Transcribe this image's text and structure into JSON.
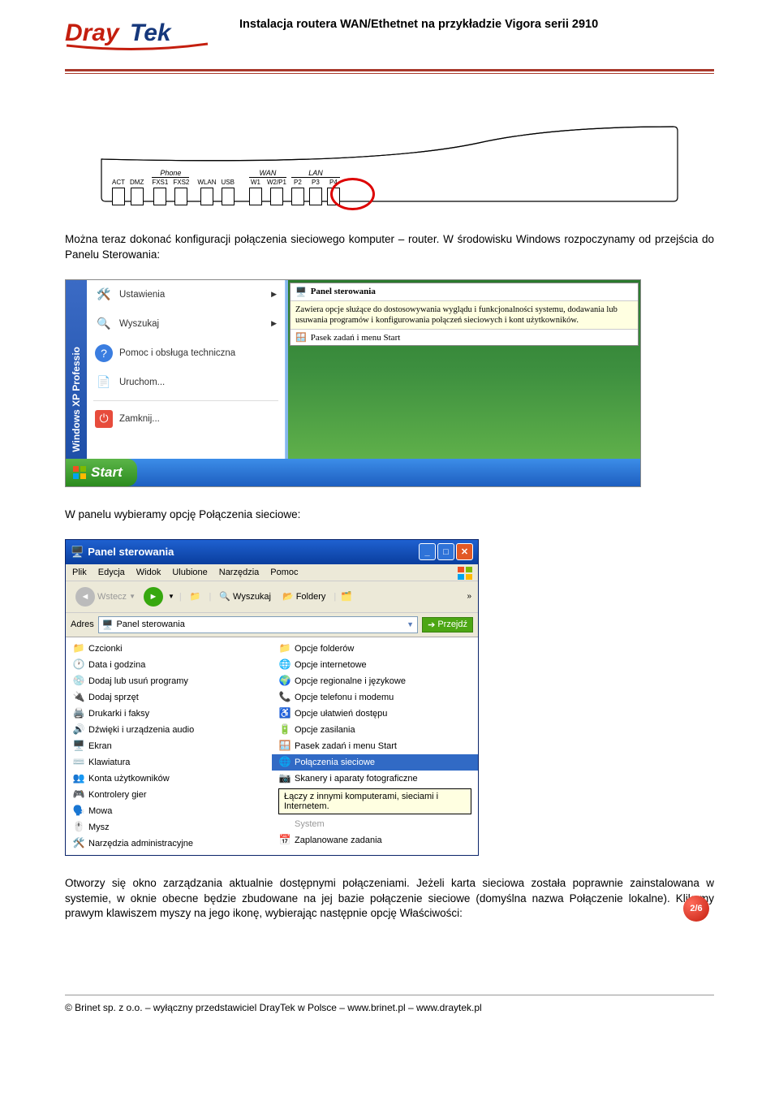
{
  "header": {
    "title": "Instalacja routera WAN/Ethetnet na przykładzie Vigora serii 2910",
    "logo_text": "DrayTek"
  },
  "router": {
    "ports_left": [
      "ACT",
      "DMZ"
    ],
    "phone_label": "Phone",
    "ports_phone": [
      "FXS1",
      "FXS2"
    ],
    "ports_mid": [
      "WLAN",
      "USB"
    ],
    "wan_label": "WAN",
    "ports_wan": [
      "W1",
      "W2/P1"
    ],
    "lan_label": "LAN",
    "ports_lan": [
      "P2",
      "P3",
      "P4"
    ]
  },
  "paragraphs": {
    "p1": "Można teraz dokonać konfiguracji połączenia sieciowego komputer – router. W środowisku Windows rozpoczynamy od przejścia do Panelu Sterowania:",
    "p2": "W panelu wybieramy opcję Połączenia sieciowe:",
    "p3": "Otworzy się okno zarządzania aktualnie dostępnymi połączeniami. Jeżeli karta sieciowa została poprawnie zainstalowana w systemie, w oknie obecne będzie zbudowane na jej bazie połączenie sieciowe (domyślna nazwa Połączenie lokalne). Klikamy prawym klawiszem myszy na jego ikonę, wybierając następnie opcję Właściwości:"
  },
  "startmenu": {
    "sidebar": "Windows XP Professio",
    "items": [
      {
        "label": "Ustawienia",
        "arrow": true
      },
      {
        "label": "Wyszukaj",
        "arrow": true
      },
      {
        "label": "Pomoc i obsługa techniczna",
        "arrow": false
      },
      {
        "label": "Uruchom...",
        "arrow": false
      },
      {
        "label": "Zamknij...",
        "arrow": false
      }
    ],
    "popup_title": "Panel sterowania",
    "popup_desc": "Zawiera opcje służące do dostosowywania wyglądu i funkcjonalności systemu, dodawania lub usuwania programów i konfigurowania połączeń sieciowych i kont użytkowników.",
    "popup_row": "Pasek zadań i menu Start",
    "start_label": "Start"
  },
  "cpanel": {
    "title": "Panel sterowania",
    "menu": [
      "Plik",
      "Edycja",
      "Widok",
      "Ulubione",
      "Narzędzia",
      "Pomoc"
    ],
    "toolbar": {
      "back": "Wstecz",
      "search": "Wyszukaj",
      "folders": "Foldery"
    },
    "address_label": "Adres",
    "address_value": "Panel sterowania",
    "go_label": "Przejdź",
    "col1": [
      "Czcionki",
      "Data i godzina",
      "Dodaj lub usuń programy",
      "Dodaj sprzęt",
      "Drukarki i faksy",
      "Dźwięki i urządzenia audio",
      "Ekran",
      "Klawiatura",
      "Konta użytkowników",
      "Kontrolery gier",
      "Mowa",
      "Mysz",
      "Narzędzia administracyjne"
    ],
    "col2": [
      "Opcje folderów",
      "Opcje internetowe",
      "Opcje regionalne i językowe",
      "Opcje telefonu i modemu",
      "Opcje ułatwień dostępu",
      "Opcje zasilania",
      "Pasek zadań i menu Start",
      "Połączenia sieciowe",
      "Skanery i aparaty fotograficzne"
    ],
    "tooltip": "Łączy z innymi komputerami, sieciami i Internetem.",
    "col2_after": [
      "System",
      "Zaplanowane zadania"
    ],
    "chevrons": "»"
  },
  "footer": {
    "text": "© Brinet sp. z o.o. – wyłączny przedstawiciel DrayTek w Polsce – www.brinet.pl – www.draytek.pl",
    "page": "2/6"
  }
}
